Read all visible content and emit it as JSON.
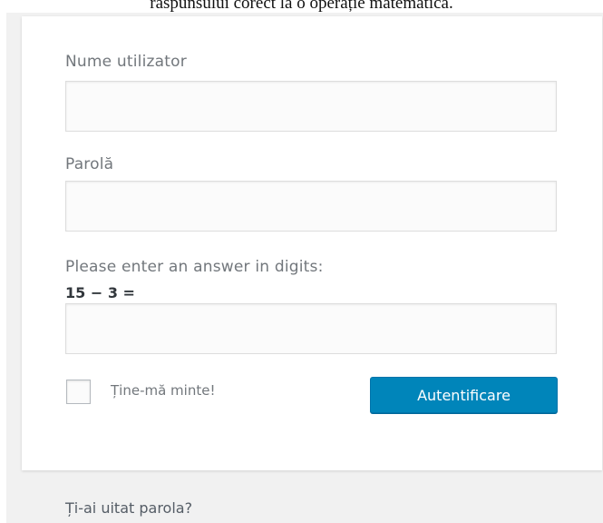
{
  "caption": {
    "text": "răspunsului corect la o operație matematică."
  },
  "login_form": {
    "username_label": "Nume utilizator",
    "username_value": "",
    "password_label": "Parolă",
    "password_value": "",
    "captcha_prompt": "Please enter an answer in digits:",
    "captcha_expression": "15 − 3 =",
    "captcha_value": "",
    "remember_me_label": "Ține-mă minte!",
    "remember_me_checked": false,
    "submit_label": "Autentificare"
  },
  "footer": {
    "lost_password_link": "Ți-ai uitat parola?"
  },
  "colors": {
    "page_background": "#f1f1f1",
    "card_background": "#ffffff",
    "label_text": "#72777c",
    "button_primary": "#0085ba",
    "input_border": "#dddddd"
  }
}
